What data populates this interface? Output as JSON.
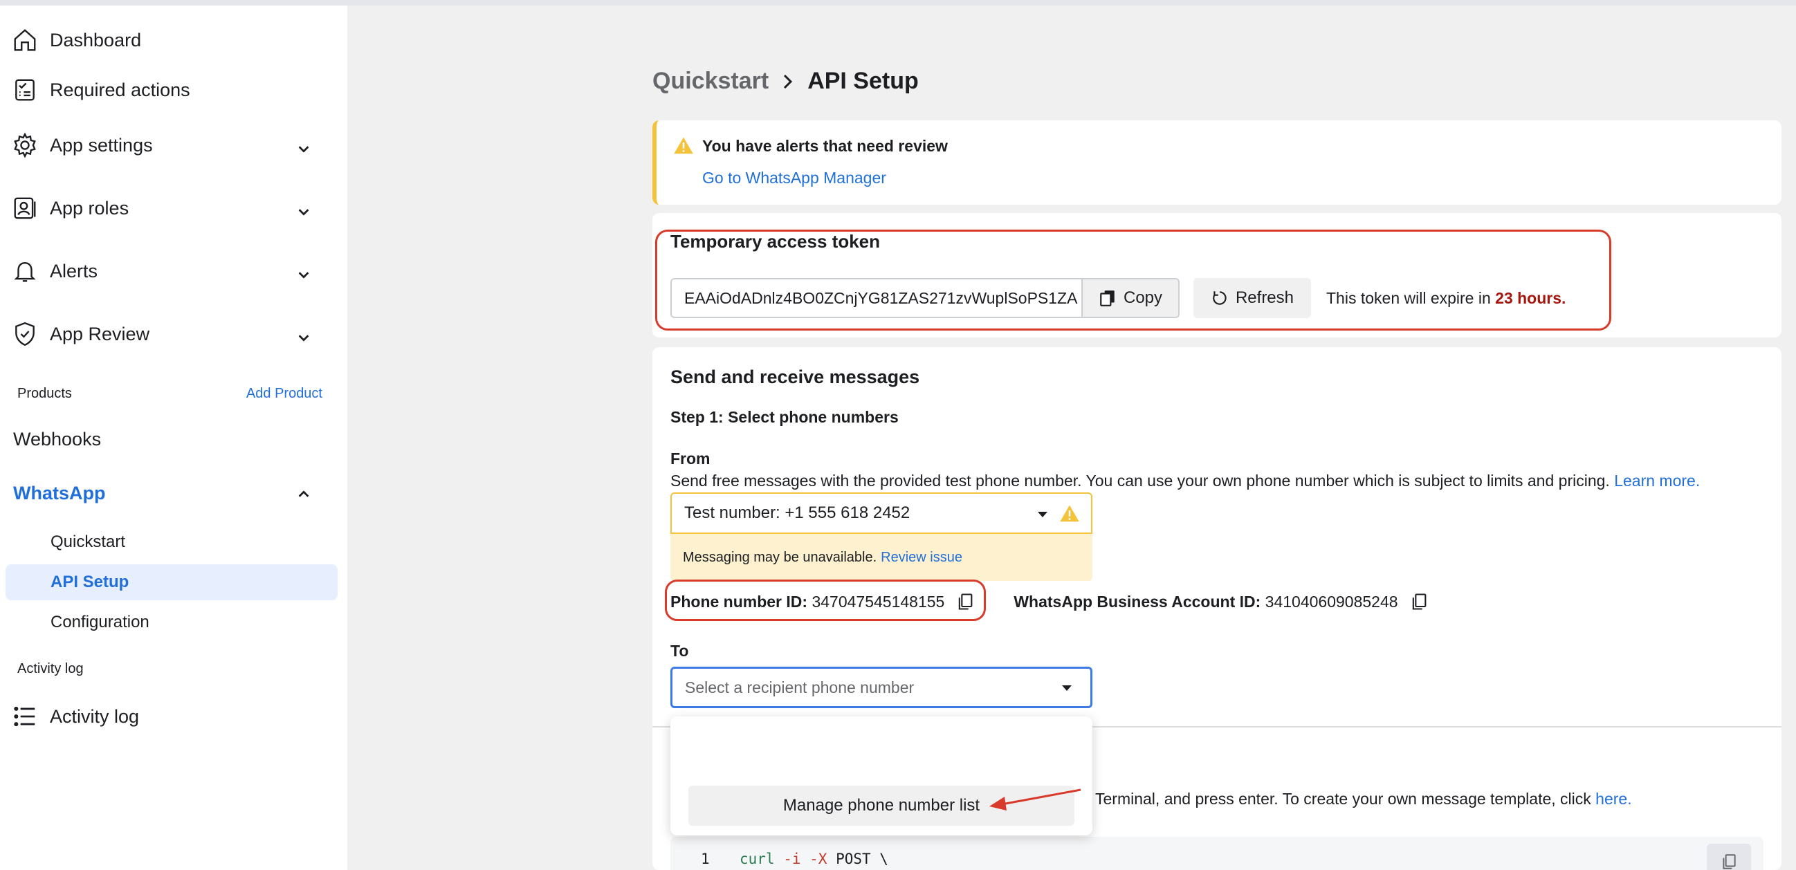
{
  "sidebar": {
    "items": [
      {
        "label": "Dashboard",
        "icon": "house-icon"
      },
      {
        "label": "Required actions",
        "icon": "checklist-icon"
      },
      {
        "label": "App settings",
        "icon": "gear-icon"
      },
      {
        "label": "App roles",
        "icon": "id-badge-icon"
      },
      {
        "label": "Alerts",
        "icon": "bell-icon"
      },
      {
        "label": "App Review",
        "icon": "shield-check-icon"
      }
    ],
    "products_label": "Products",
    "add_product": "Add Product",
    "webhooks": "Webhooks",
    "whatsapp": "WhatsApp",
    "whatsapp_sub": [
      "Quickstart",
      "API Setup",
      "Configuration"
    ],
    "activity_section": "Activity log",
    "activity_item": "Activity log"
  },
  "breadcrumb": {
    "parent": "Quickstart",
    "current": "API Setup"
  },
  "alert": {
    "title": "You have alerts that need review",
    "link": "Go to WhatsApp Manager"
  },
  "token": {
    "title": "Temporary access token",
    "value": "EAAiOdADnlz4BO0ZCnjYG81ZAS271zvWuplSoPS1ZA",
    "copy": "Copy",
    "refresh": "Refresh",
    "expire_prefix": "This token will expire in ",
    "expire_value": "23 hours."
  },
  "messages": {
    "title": "Send and receive messages",
    "step1": "Step 1: Select phone numbers",
    "from_label": "From",
    "from_desc": "Send free messages with the provided test phone number. You can use your own phone number which is subject to limits and pricing.",
    "learn_more": "Learn more.",
    "from_selected": "Test number: +1 555 618 2452",
    "unavailable": "Messaging may be unavailable.",
    "review_issue": "Review issue",
    "phone_id_label": "Phone number ID:",
    "phone_id": "347047545148155",
    "waba_label": "WhatsApp Business Account ID:",
    "waba_id": "341040609085248",
    "to_label": "To",
    "to_placeholder": "Select a recipient phone number",
    "step2_text": "Terminal, and press enter. To create your own message template, click",
    "step2_link": "here.",
    "code_line_no": "1",
    "code_cmd": "curl",
    "code_flags": "-i -X",
    "code_rest": " POST \\"
  },
  "dropdown": {
    "manage": "Manage phone number list"
  },
  "colors": {
    "link": "#216fdb",
    "highlight": "#d93b2b",
    "warning": "#f5c33b"
  }
}
